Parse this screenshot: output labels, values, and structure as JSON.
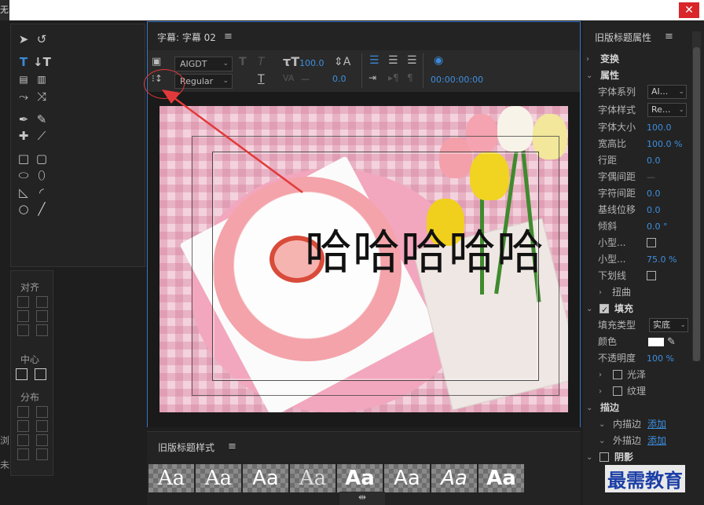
{
  "window": {
    "app_title_fragment": "无",
    "close_label": "✕"
  },
  "left_panel": {
    "align_label": "对齐",
    "center_label": "中心",
    "distribute_label": "分布",
    "edge_labels": [
      "浏",
      "未"
    ]
  },
  "title_panel": {
    "title": "字幕: 字幕 02",
    "font_family": "AIGDT",
    "font_style": "Regular",
    "font_size": "100.0",
    "leading": "0.0",
    "timecode": "00:00:00:00",
    "dash": "—",
    "overlay_text": "哈哈哈哈哈"
  },
  "styles_panel": {
    "title": "旧版标题样式",
    "samples": [
      "Aa",
      "Aa",
      "Aa",
      "Aa",
      "Aa",
      "Aa",
      "Aa",
      "Aa"
    ]
  },
  "properties": {
    "title": "旧版标题属性",
    "transform": "变换",
    "props": "属性",
    "font_family_label": "字体系列",
    "font_family_value": "AI...",
    "font_style_label": "字体样式",
    "font_style_value": "Re...",
    "font_size_label": "字体大小",
    "font_size_value": "100.0",
    "aspect_label": "宽高比",
    "aspect_value": "100.0 %",
    "leading_label": "行距",
    "leading_value": "0.0",
    "kerning_label": "字偶间距",
    "kerning_value": "—",
    "tracking_label": "字符间距",
    "tracking_value": "0.0",
    "baseline_label": "基线位移",
    "baseline_value": "0.0",
    "slant_label": "倾斜",
    "slant_value": "0.0 °",
    "smallcaps_label": "小型...",
    "smallcaps_size_label": "小型...",
    "smallcaps_size_value": "75.0 %",
    "underline_label": "下划线",
    "distort_label": "扭曲",
    "fill_label": "填充",
    "fill_type_label": "填充类型",
    "fill_type_value": "实底",
    "color_label": "颜色",
    "opacity_label": "不透明度",
    "opacity_value": "100 %",
    "sheen_label": "光泽",
    "texture_label": "纹理",
    "stroke_label": "描边",
    "inner_stroke_label": "内描边",
    "inner_stroke_action": "添加",
    "outer_stroke_label": "外描边",
    "outer_stroke_action": "添加",
    "shadow_label": "阴影"
  },
  "watermark": "最需教育",
  "colors": {
    "accent": "#3d8fe0",
    "selection_border": "#3576c7",
    "annotation": "#e23a3a"
  }
}
